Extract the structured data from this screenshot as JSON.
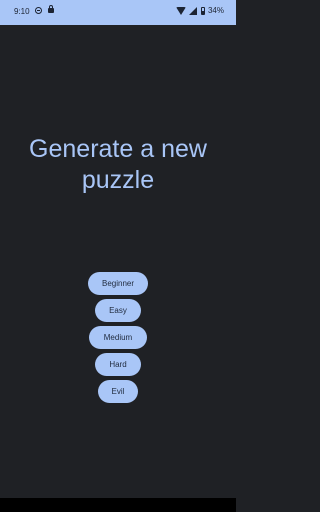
{
  "status_bar": {
    "time": "9:10",
    "battery_percent": "34%",
    "icons": [
      "do-not-disturb-icon",
      "lock-icon",
      "wifi-icon",
      "signal-icon",
      "battery-icon"
    ]
  },
  "screen": {
    "title": "Generate a new puzzle"
  },
  "difficulties": [
    {
      "label": "Beginner"
    },
    {
      "label": "Easy"
    },
    {
      "label": "Medium"
    },
    {
      "label": "Hard"
    },
    {
      "label": "Evil"
    }
  ],
  "colors": {
    "accent": "#a9c6f7",
    "background": "#1f2125",
    "button_text": "#1f2a3d"
  }
}
